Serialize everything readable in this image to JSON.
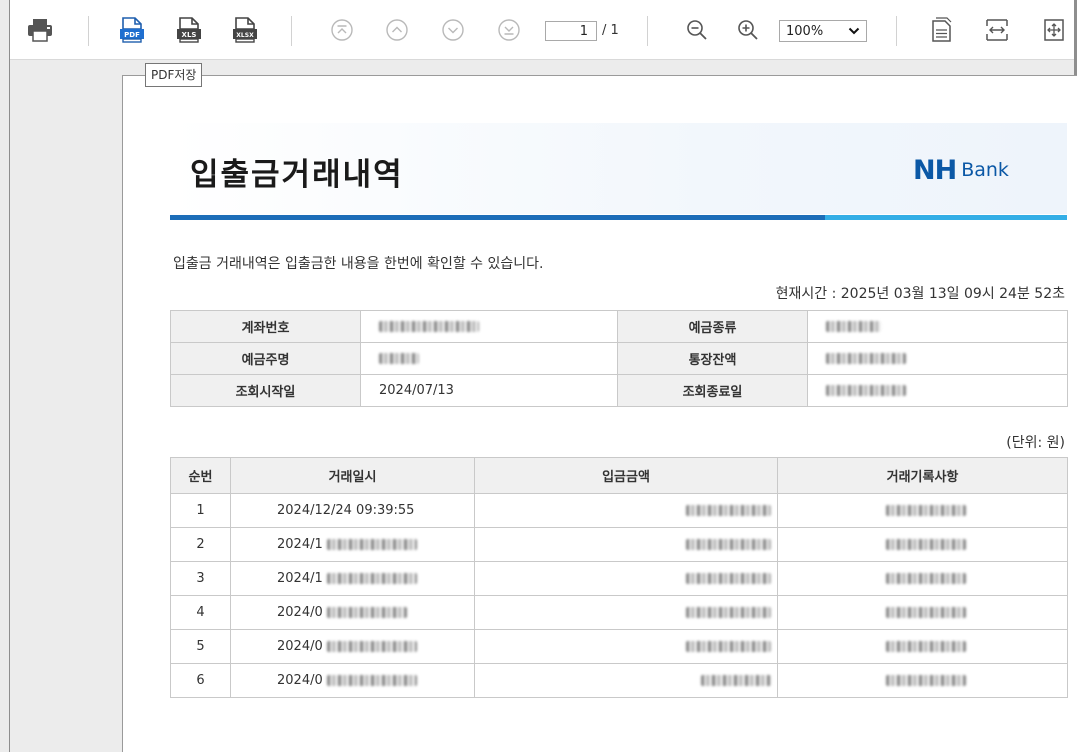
{
  "toolbar": {
    "page_current": "1",
    "page_total": "/ 1",
    "zoom": "100%",
    "tooltip": "PDF저장"
  },
  "document": {
    "title": "입출금거래내역",
    "logo_nh": "NH",
    "logo_bank": "Bank",
    "description": "입출금 거래내역은 입출금한 내용을 한번에 확인할 수 있습니다.",
    "current_time": "현재시간 : 2025년 03월 13일 09시 24분 52초",
    "info": {
      "account_no_label": "계좌번호",
      "deposit_type_label": "예금종류",
      "owner_label": "예금주명",
      "balance_label": "통장잔액",
      "start_date_label": "조회시작일",
      "start_date": "2024/07/13",
      "end_date_label": "조회종료일"
    },
    "unit": "(단위: 원)",
    "columns": {
      "seq": "순번",
      "date": "거래일시",
      "amount": "입금금액",
      "memo": "거래기록사항"
    },
    "rows": [
      {
        "seq": "1",
        "date": "2024/12/24 09:39:55"
      },
      {
        "seq": "2",
        "date": "2024/1"
      },
      {
        "seq": "3",
        "date": "2024/1"
      },
      {
        "seq": "4",
        "date": "2024/0"
      },
      {
        "seq": "5",
        "date": "2024/0"
      },
      {
        "seq": "6",
        "date": "2024/0"
      }
    ]
  },
  "colors": {
    "accent_blue": "#1c6db8",
    "accent_sky": "#33aee6",
    "logo_blue": "#0b58a6"
  }
}
